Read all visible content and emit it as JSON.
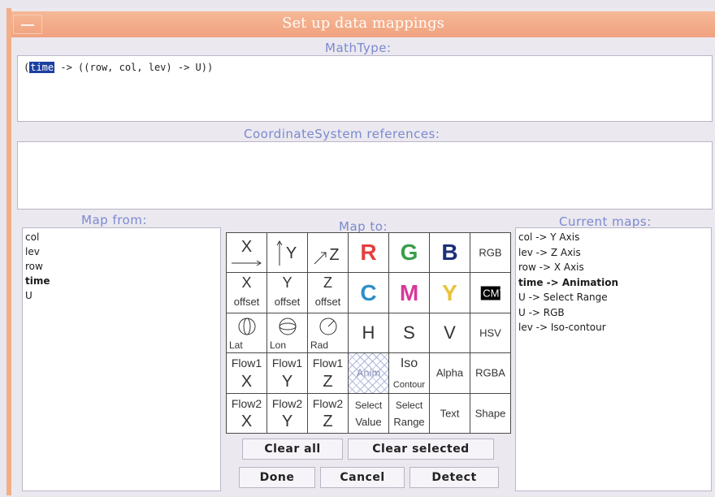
{
  "window": {
    "title": "Set up data mappings"
  },
  "mathtype": {
    "label": "MathType:",
    "prefix": "(",
    "selected": "time",
    "rest": " -> ((row, col, lev) -> U))"
  },
  "coord": {
    "label": "CoordinateSystem references:"
  },
  "map_from": {
    "label": "Map from:",
    "items": [
      "col",
      "lev",
      "row",
      "time",
      "U"
    ]
  },
  "map_to": {
    "label": "Map to:",
    "cells": {
      "x": "X",
      "y": "Y",
      "z": "Z",
      "r": "R",
      "g": "G",
      "b": "B",
      "rgb": "RGB",
      "x_off_top": "X",
      "y_off_top": "Y",
      "z_off_top": "Z",
      "offset": "offset",
      "c": "C",
      "m": "M",
      "yel": "Y",
      "cmy": "CMY",
      "lat": "Lat",
      "lon": "Lon",
      "rad": "Rad",
      "h": "H",
      "s": "S",
      "v": "V",
      "hsv": "HSV",
      "flow1": "Flow1",
      "fx": "X",
      "fy": "Y",
      "fz": "Z",
      "anim": "Anim",
      "iso_top": "Iso",
      "iso_bottom": "Contour",
      "alpha": "Alpha",
      "rgba": "RGBA",
      "flow2": "Flow2",
      "select": "Select",
      "value": "Value",
      "range": "Range",
      "text": "Text",
      "shape": "Shape"
    }
  },
  "current_maps": {
    "label": "Current maps:",
    "items": [
      {
        "text": "col -> Y Axis",
        "bold": false
      },
      {
        "text": "lev -> Z Axis",
        "bold": false
      },
      {
        "text": "row -> X Axis",
        "bold": false
      },
      {
        "text": "time -> Animation",
        "bold": true
      },
      {
        "text": "U -> Select Range",
        "bold": false
      },
      {
        "text": "U -> RGB",
        "bold": false
      },
      {
        "text": "lev -> Iso-contour",
        "bold": false
      }
    ]
  },
  "buttons": {
    "clear_all": "Clear all",
    "clear_selected": "Clear selected",
    "done": "Done",
    "cancel": "Cancel",
    "detect": "Detect"
  },
  "colors": {
    "red": "#e2403f",
    "green": "#3a9e4a",
    "blue": "#1c2f7a",
    "cyan": "#2f8fc9",
    "magenta": "#d6389a",
    "yellow": "#e6c43a"
  }
}
